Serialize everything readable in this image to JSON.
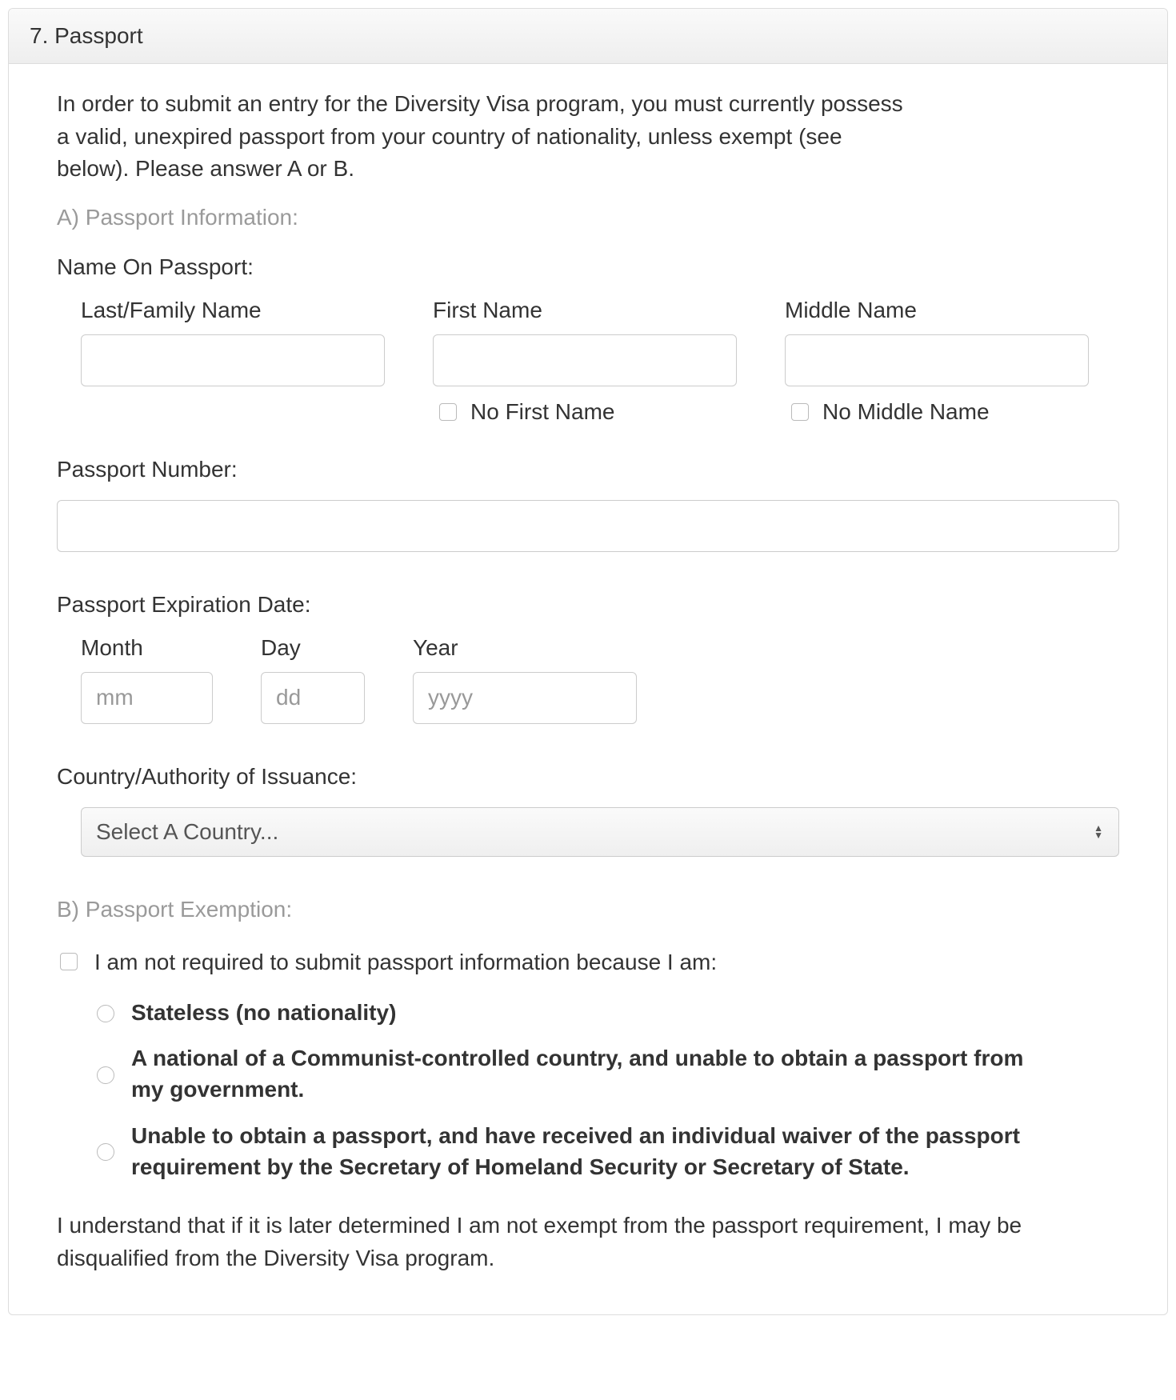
{
  "header": {
    "title": "7. Passport"
  },
  "intro": "In order to submit an entry for the Diversity Visa program, you must currently possess a valid, unexpired passport from your country of nationality, unless exempt (see below). Please answer A or B.",
  "sectionA": {
    "title": "A) Passport Information:",
    "name_on_passport_label": "Name On Passport:",
    "last_name_label": "Last/Family Name",
    "first_name_label": "First Name",
    "middle_name_label": "Middle Name",
    "no_first_name_label": "No First Name",
    "no_middle_name_label": "No Middle Name",
    "passport_number_label": "Passport Number:",
    "expiration_label": "Passport Expiration Date:",
    "month_label": "Month",
    "day_label": "Day",
    "year_label": "Year",
    "month_placeholder": "mm",
    "day_placeholder": "dd",
    "year_placeholder": "yyyy",
    "issuance_label": "Country/Authority of Issuance:",
    "country_placeholder": "Select A Country..."
  },
  "sectionB": {
    "title": "B) Passport Exemption:",
    "exempt_prompt": "I am not required to submit passport information because I am:",
    "options": {
      "stateless": "Stateless (no nationality)",
      "communist": "A national of a Communist-controlled country, and unable to obtain a passport from my government.",
      "waiver": "Unable to obtain a passport, and have received an individual waiver of the passport requirement by the Secretary of Homeland Security or Secretary of State."
    },
    "disclaimer": "I understand that if it is later determined I am not exempt from the passport requirement, I may be disqualified from the Diversity Visa program."
  }
}
